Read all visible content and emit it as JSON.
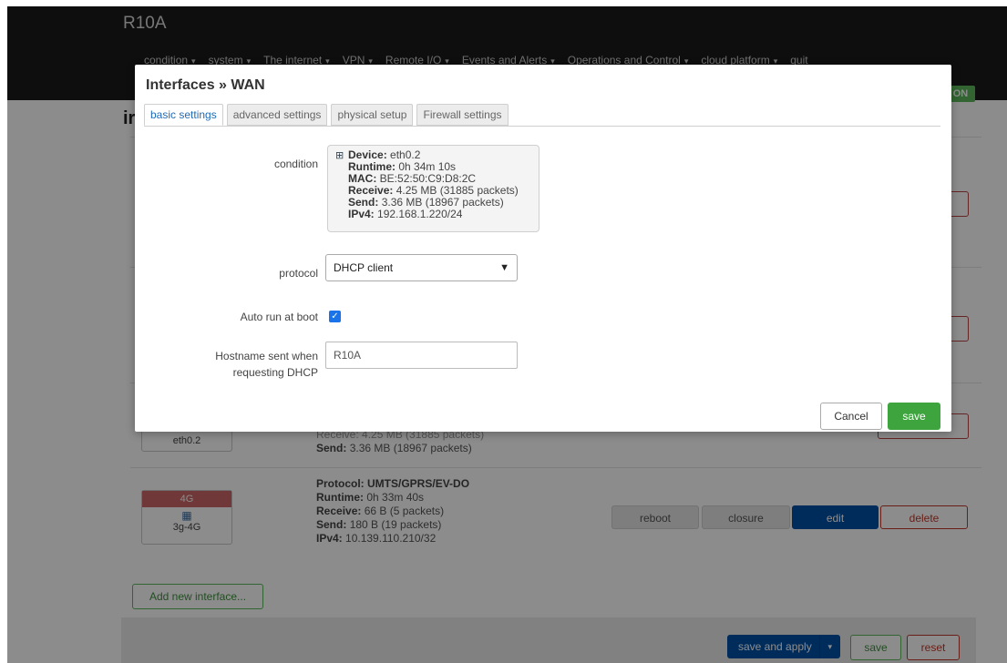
{
  "header": {
    "brand": "R10A",
    "nav": [
      "condition",
      "system",
      "The internet",
      "VPN",
      "Remote I/O",
      "Events and Alerts",
      "Operations and Control",
      "cloud platform",
      "quit"
    ],
    "nav_caret": "▾",
    "badge": "ON"
  },
  "page": {
    "heading": "ir",
    "interfaces": [
      {
        "zone": "",
        "name": "eth0.2",
        "info_partial": "Receive: 4.25 MB (31885 packets)",
        "send": "3.36 MB (18967 packets)",
        "send_label": "Send:"
      },
      {
        "zone": "4G",
        "name": "3g-4G",
        "protocol_label": "Protocol:",
        "protocol": "UMTS/GPRS/EV-DO",
        "runtime_label": "Runtime:",
        "runtime": "0h 33m 40s",
        "receive_label": "Receive:",
        "receive": "66 B (5 packets)",
        "send_label": "Send:",
        "send": "180 B (19 packets)",
        "ipv4_label": "IPv4:",
        "ipv4": "10.139.110.210/32"
      }
    ],
    "actions": {
      "reboot": "reboot",
      "closure": "closure",
      "edit": "edit",
      "delete": "delete"
    },
    "add_interface": "Add new interface...",
    "footer": {
      "save_apply": "save and apply",
      "save": "save",
      "reset": "reset"
    }
  },
  "modal": {
    "title": "Interfaces » WAN",
    "tabs": [
      "basic settings",
      "advanced settings",
      "physical setup",
      "Firewall settings"
    ],
    "condition_label": "condition",
    "status": {
      "device_label": "Device:",
      "device": "eth0.2",
      "runtime_label": "Runtime:",
      "runtime": "0h 34m 10s",
      "mac_label": "MAC:",
      "mac": "BE:52:50:C9:D8:2C",
      "receive_label": "Receive:",
      "receive": "4.25 MB (31885 packets)",
      "send_label": "Send:",
      "send": "3.36 MB (18967 packets)",
      "ipv4_label": "IPv4:",
      "ipv4": "192.168.1.220/24"
    },
    "protocol_label": "protocol",
    "protocol_value": "DHCP client",
    "autorun_label": "Auto run at boot",
    "autorun_checked": true,
    "hostname_label": "Hostname sent when requesting DHCP",
    "hostname_value": "R10A",
    "cancel": "Cancel",
    "save": "save"
  }
}
